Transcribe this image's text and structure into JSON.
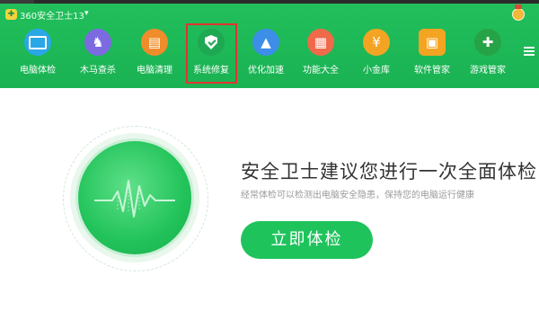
{
  "app": {
    "title": "360安全卫士13",
    "dropdown_icon": "caret-down-icon",
    "medal_icon": "medal-icon",
    "accent_color": "#1fc35c"
  },
  "nav": {
    "items": [
      {
        "label": "电脑体检",
        "icon": "monitor-icon",
        "color": "#2aa7e6"
      },
      {
        "label": "木马查杀",
        "icon": "horse-icon",
        "color": "#7b6ae0"
      },
      {
        "label": "电脑清理",
        "icon": "broom-icon",
        "color": "#f08c2a"
      },
      {
        "label": "系统修复",
        "icon": "shield-icon",
        "color": "#1ea852"
      },
      {
        "label": "优化加速",
        "icon": "rocket-icon",
        "color": "#3c8ee8"
      },
      {
        "label": "功能大全",
        "icon": "grid-icon",
        "color": "#ee6a4b"
      },
      {
        "label": "小金库",
        "icon": "moneybag-icon",
        "color": "#f4a423"
      },
      {
        "label": "软件管家",
        "icon": "apps-icon",
        "color": "#f4a423"
      },
      {
        "label": "游戏管家",
        "icon": "gamepad-icon",
        "color": "#27a347"
      }
    ],
    "selected_index": 3,
    "menu_icon": "hamburger-icon"
  },
  "main": {
    "headline": "安全卫士建议您进行一次全面体检",
    "subline": "经常体检可以检测出电脑安全隐患，保持您的电脑运行健康",
    "button_label": "立即体检"
  }
}
